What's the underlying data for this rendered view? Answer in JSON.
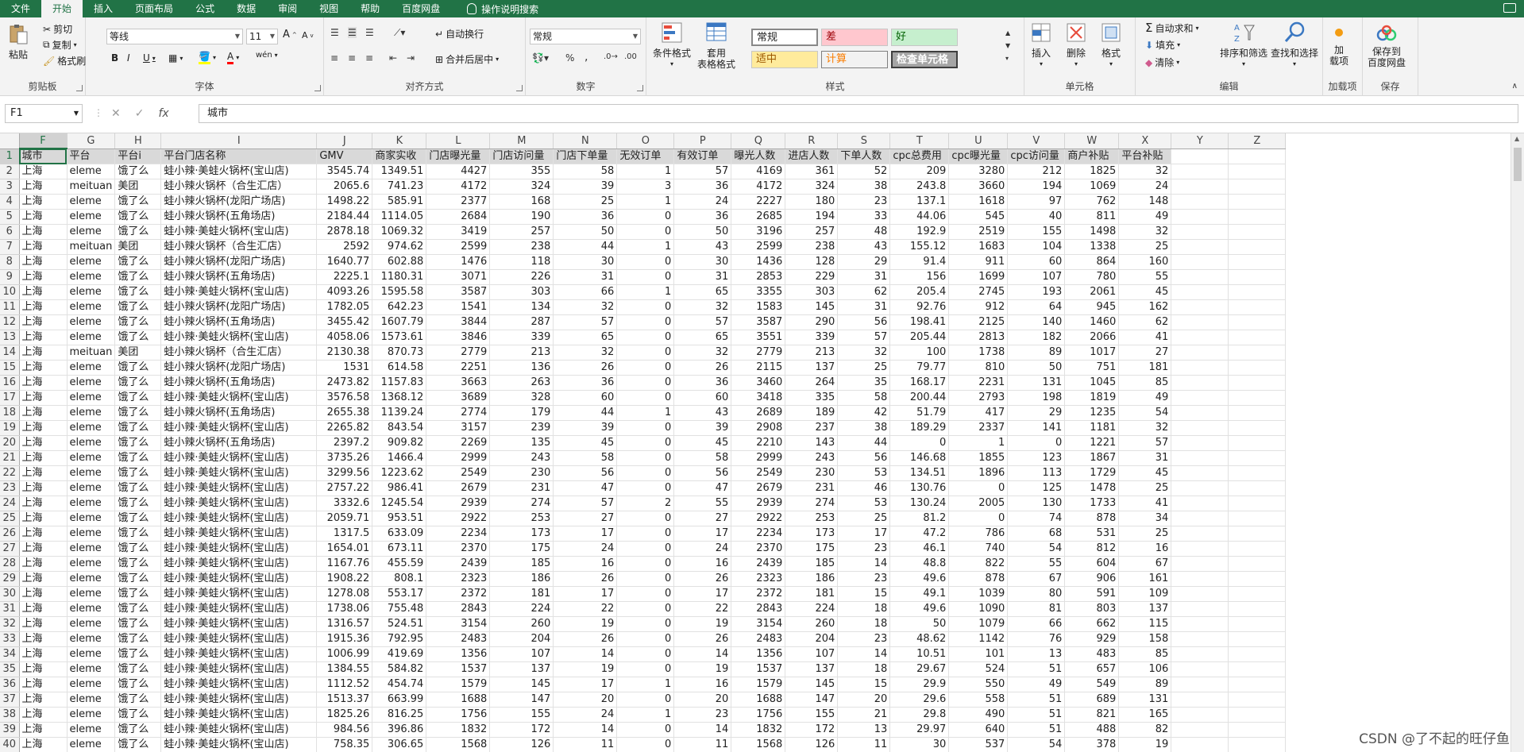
{
  "tabs": [
    "文件",
    "开始",
    "插入",
    "页面布局",
    "公式",
    "数据",
    "审阅",
    "视图",
    "帮助",
    "百度网盘"
  ],
  "active_tab": "开始",
  "tell_me": "操作说明搜索",
  "ribbon": {
    "clipboard": {
      "paste": "粘贴",
      "cut": "剪切",
      "copy": "复制",
      "format_painter": "格式刷",
      "label": "剪贴板"
    },
    "font": {
      "name": "等线",
      "size": "11",
      "grow": "A",
      "shrink": "A",
      "bold": "B",
      "italic": "I",
      "underline": "U",
      "label": "字体",
      "phonetic": "wén"
    },
    "alignment": {
      "wrap": "自动换行",
      "merge": "合并后居中",
      "label": "对齐方式"
    },
    "number": {
      "format": "常规",
      "percent": "%",
      "comma": ",",
      "label": "数字"
    },
    "styles": {
      "conditional": "条件格式",
      "table": "套用\n表格格式",
      "normal": "常规",
      "bad": "差",
      "good": "好",
      "neutral": "适中",
      "calc": "计算",
      "check": "检查单元格",
      "label": "样式"
    },
    "cells": {
      "insert": "插入",
      "delete": "删除",
      "format": "格式",
      "label": "单元格"
    },
    "editing": {
      "autosum": "自动求和",
      "fill": "填充",
      "clear": "清除",
      "sort": "排序和筛选",
      "find": "查找和选择",
      "label": "编辑"
    },
    "addins": {
      "btn": "加\n载项",
      "label": "加载项"
    },
    "save": {
      "btn": "保存到\n百度网盘",
      "label": "保存"
    }
  },
  "colors": {
    "excel_green": "#217346",
    "bad_fill": "#ffc7ce",
    "bad_text": "#9c0006",
    "good_fill": "#c6efce",
    "good_text": "#006100",
    "neutral_fill": "#ffeb9c",
    "neutral_text": "#9c5700",
    "calc_text": "#fa7d00",
    "check_fill": "#a5a5a5"
  },
  "name_box": "F1",
  "formula": "城市",
  "watermark": "CSDN @了不起的旺仔鱼",
  "columns": [
    "F",
    "G",
    "H",
    "I",
    "J",
    "K",
    "L",
    "M",
    "N",
    "O",
    "P",
    "Q",
    "R",
    "S",
    "T",
    "U",
    "V",
    "W",
    "X",
    "Y",
    "Z"
  ],
  "header_row": [
    "城市",
    "平台",
    "平台i",
    "平台门店名称",
    "GMV",
    "商家实收",
    "门店曝光量",
    "门店访问量",
    "门店下单量",
    "无效订单",
    "有效订单",
    "曝光人数",
    "进店人数",
    "下单人数",
    "cpc总费用",
    "cpc曝光量",
    "cpc访问量",
    "商户补贴",
    "平台补贴",
    "",
    ""
  ],
  "rows": [
    [
      "上海",
      "eleme",
      "饿了么",
      "蛙小辣·美蛙火锅杯(宝山店)",
      "3545.74",
      "1349.51",
      "4427",
      "355",
      "58",
      "1",
      "57",
      "4169",
      "361",
      "52",
      "209",
      "3280",
      "212",
      "1825",
      "32"
    ],
    [
      "上海",
      "meituan",
      "美团",
      "蛙小辣火锅杯（合生汇店）",
      "2065.6",
      "741.23",
      "4172",
      "324",
      "39",
      "3",
      "36",
      "4172",
      "324",
      "38",
      "243.8",
      "3660",
      "194",
      "1069",
      "24"
    ],
    [
      "上海",
      "eleme",
      "饿了么",
      "蛙小辣火锅杯(龙阳广场店)",
      "1498.22",
      "585.91",
      "2377",
      "168",
      "25",
      "1",
      "24",
      "2227",
      "180",
      "23",
      "137.1",
      "1618",
      "97",
      "762",
      "148"
    ],
    [
      "上海",
      "eleme",
      "饿了么",
      "蛙小辣火锅杯(五角场店)",
      "2184.44",
      "1114.05",
      "2684",
      "190",
      "36",
      "0",
      "36",
      "2685",
      "194",
      "33",
      "44.06",
      "545",
      "40",
      "811",
      "49"
    ],
    [
      "上海",
      "eleme",
      "饿了么",
      "蛙小辣·美蛙火锅杯(宝山店)",
      "2878.18",
      "1069.32",
      "3419",
      "257",
      "50",
      "0",
      "50",
      "3196",
      "257",
      "48",
      "192.9",
      "2519",
      "155",
      "1498",
      "32"
    ],
    [
      "上海",
      "meituan",
      "美团",
      "蛙小辣火锅杯（合生汇店）",
      "2592",
      "974.62",
      "2599",
      "238",
      "44",
      "1",
      "43",
      "2599",
      "238",
      "43",
      "155.12",
      "1683",
      "104",
      "1338",
      "25"
    ],
    [
      "上海",
      "eleme",
      "饿了么",
      "蛙小辣火锅杯(龙阳广场店)",
      "1640.77",
      "602.88",
      "1476",
      "118",
      "30",
      "0",
      "30",
      "1436",
      "128",
      "29",
      "91.4",
      "911",
      "60",
      "864",
      "160"
    ],
    [
      "上海",
      "eleme",
      "饿了么",
      "蛙小辣火锅杯(五角场店)",
      "2225.1",
      "1180.31",
      "3071",
      "226",
      "31",
      "0",
      "31",
      "2853",
      "229",
      "31",
      "156",
      "1699",
      "107",
      "780",
      "55"
    ],
    [
      "上海",
      "eleme",
      "饿了么",
      "蛙小辣·美蛙火锅杯(宝山店)",
      "4093.26",
      "1595.58",
      "3587",
      "303",
      "66",
      "1",
      "65",
      "3355",
      "303",
      "62",
      "205.4",
      "2745",
      "193",
      "2061",
      "45"
    ],
    [
      "上海",
      "eleme",
      "饿了么",
      "蛙小辣火锅杯(龙阳广场店)",
      "1782.05",
      "642.23",
      "1541",
      "134",
      "32",
      "0",
      "32",
      "1583",
      "145",
      "31",
      "92.76",
      "912",
      "64",
      "945",
      "162"
    ],
    [
      "上海",
      "eleme",
      "饿了么",
      "蛙小辣火锅杯(五角场店)",
      "3455.42",
      "1607.79",
      "3844",
      "287",
      "57",
      "0",
      "57",
      "3587",
      "290",
      "56",
      "198.41",
      "2125",
      "140",
      "1460",
      "62"
    ],
    [
      "上海",
      "eleme",
      "饿了么",
      "蛙小辣·美蛙火锅杯(宝山店)",
      "4058.06",
      "1573.61",
      "3846",
      "339",
      "65",
      "0",
      "65",
      "3551",
      "339",
      "57",
      "205.44",
      "2813",
      "182",
      "2066",
      "41"
    ],
    [
      "上海",
      "meituan",
      "美团",
      "蛙小辣火锅杯（合生汇店）",
      "2130.38",
      "870.73",
      "2779",
      "213",
      "32",
      "0",
      "32",
      "2779",
      "213",
      "32",
      "100",
      "1738",
      "89",
      "1017",
      "27"
    ],
    [
      "上海",
      "eleme",
      "饿了么",
      "蛙小辣火锅杯(龙阳广场店)",
      "1531",
      "614.58",
      "2251",
      "136",
      "26",
      "0",
      "26",
      "2115",
      "137",
      "25",
      "79.77",
      "810",
      "50",
      "751",
      "181"
    ],
    [
      "上海",
      "eleme",
      "饿了么",
      "蛙小辣火锅杯(五角场店)",
      "2473.82",
      "1157.83",
      "3663",
      "263",
      "36",
      "0",
      "36",
      "3460",
      "264",
      "35",
      "168.17",
      "2231",
      "131",
      "1045",
      "85"
    ],
    [
      "上海",
      "eleme",
      "饿了么",
      "蛙小辣·美蛙火锅杯(宝山店)",
      "3576.58",
      "1368.12",
      "3689",
      "328",
      "60",
      "0",
      "60",
      "3418",
      "335",
      "58",
      "200.44",
      "2793",
      "198",
      "1819",
      "49"
    ],
    [
      "上海",
      "eleme",
      "饿了么",
      "蛙小辣火锅杯(五角场店)",
      "2655.38",
      "1139.24",
      "2774",
      "179",
      "44",
      "1",
      "43",
      "2689",
      "189",
      "42",
      "51.79",
      "417",
      "29",
      "1235",
      "54"
    ],
    [
      "上海",
      "eleme",
      "饿了么",
      "蛙小辣·美蛙火锅杯(宝山店)",
      "2265.82",
      "843.54",
      "3157",
      "239",
      "39",
      "0",
      "39",
      "2908",
      "237",
      "38",
      "189.29",
      "2337",
      "141",
      "1181",
      "32"
    ],
    [
      "上海",
      "eleme",
      "饿了么",
      "蛙小辣火锅杯(五角场店)",
      "2397.2",
      "909.82",
      "2269",
      "135",
      "45",
      "0",
      "45",
      "2210",
      "143",
      "44",
      "0",
      "1",
      "0",
      "1221",
      "57"
    ],
    [
      "上海",
      "eleme",
      "饿了么",
      "蛙小辣·美蛙火锅杯(宝山店)",
      "3735.26",
      "1466.4",
      "2999",
      "243",
      "58",
      "0",
      "58",
      "2999",
      "243",
      "56",
      "146.68",
      "1855",
      "123",
      "1867",
      "31"
    ],
    [
      "上海",
      "eleme",
      "饿了么",
      "蛙小辣·美蛙火锅杯(宝山店)",
      "3299.56",
      "1223.62",
      "2549",
      "230",
      "56",
      "0",
      "56",
      "2549",
      "230",
      "53",
      "134.51",
      "1896",
      "113",
      "1729",
      "45"
    ],
    [
      "上海",
      "eleme",
      "饿了么",
      "蛙小辣·美蛙火锅杯(宝山店)",
      "2757.22",
      "986.41",
      "2679",
      "231",
      "47",
      "0",
      "47",
      "2679",
      "231",
      "46",
      "130.76",
      "0",
      "125",
      "1478",
      "25"
    ],
    [
      "上海",
      "eleme",
      "饿了么",
      "蛙小辣·美蛙火锅杯(宝山店)",
      "3332.6",
      "1245.54",
      "2939",
      "274",
      "57",
      "2",
      "55",
      "2939",
      "274",
      "53",
      "130.24",
      "2005",
      "130",
      "1733",
      "41"
    ],
    [
      "上海",
      "eleme",
      "饿了么",
      "蛙小辣·美蛙火锅杯(宝山店)",
      "2059.71",
      "953.51",
      "2922",
      "253",
      "27",
      "0",
      "27",
      "2922",
      "253",
      "25",
      "81.2",
      "0",
      "74",
      "878",
      "34"
    ],
    [
      "上海",
      "eleme",
      "饿了么",
      "蛙小辣·美蛙火锅杯(宝山店)",
      "1317.5",
      "633.09",
      "2234",
      "173",
      "17",
      "0",
      "17",
      "2234",
      "173",
      "17",
      "47.2",
      "786",
      "68",
      "531",
      "25"
    ],
    [
      "上海",
      "eleme",
      "饿了么",
      "蛙小辣·美蛙火锅杯(宝山店)",
      "1654.01",
      "673.11",
      "2370",
      "175",
      "24",
      "0",
      "24",
      "2370",
      "175",
      "23",
      "46.1",
      "740",
      "54",
      "812",
      "16"
    ],
    [
      "上海",
      "eleme",
      "饿了么",
      "蛙小辣·美蛙火锅杯(宝山店)",
      "1167.76",
      "455.59",
      "2439",
      "185",
      "16",
      "0",
      "16",
      "2439",
      "185",
      "14",
      "48.8",
      "822",
      "55",
      "604",
      "67"
    ],
    [
      "上海",
      "eleme",
      "饿了么",
      "蛙小辣·美蛙火锅杯(宝山店)",
      "1908.22",
      "808.1",
      "2323",
      "186",
      "26",
      "0",
      "26",
      "2323",
      "186",
      "23",
      "49.6",
      "878",
      "67",
      "906",
      "161"
    ],
    [
      "上海",
      "eleme",
      "饿了么",
      "蛙小辣·美蛙火锅杯(宝山店)",
      "1278.08",
      "553.17",
      "2372",
      "181",
      "17",
      "0",
      "17",
      "2372",
      "181",
      "15",
      "49.1",
      "1039",
      "80",
      "591",
      "109"
    ],
    [
      "上海",
      "eleme",
      "饿了么",
      "蛙小辣·美蛙火锅杯(宝山店)",
      "1738.06",
      "755.48",
      "2843",
      "224",
      "22",
      "0",
      "22",
      "2843",
      "224",
      "18",
      "49.6",
      "1090",
      "81",
      "803",
      "137"
    ],
    [
      "上海",
      "eleme",
      "饿了么",
      "蛙小辣·美蛙火锅杯(宝山店)",
      "1316.57",
      "524.51",
      "3154",
      "260",
      "19",
      "0",
      "19",
      "3154",
      "260",
      "18",
      "50",
      "1079",
      "66",
      "662",
      "115"
    ],
    [
      "上海",
      "eleme",
      "饿了么",
      "蛙小辣·美蛙火锅杯(宝山店)",
      "1915.36",
      "792.95",
      "2483",
      "204",
      "26",
      "0",
      "26",
      "2483",
      "204",
      "23",
      "48.62",
      "1142",
      "76",
      "929",
      "158"
    ],
    [
      "上海",
      "eleme",
      "饿了么",
      "蛙小辣·美蛙火锅杯(宝山店)",
      "1006.99",
      "419.69",
      "1356",
      "107",
      "14",
      "0",
      "14",
      "1356",
      "107",
      "14",
      "10.51",
      "101",
      "13",
      "483",
      "85"
    ],
    [
      "上海",
      "eleme",
      "饿了么",
      "蛙小辣·美蛙火锅杯(宝山店)",
      "1384.55",
      "584.82",
      "1537",
      "137",
      "19",
      "0",
      "19",
      "1537",
      "137",
      "18",
      "29.67",
      "524",
      "51",
      "657",
      "106"
    ],
    [
      "上海",
      "eleme",
      "饿了么",
      "蛙小辣·美蛙火锅杯(宝山店)",
      "1112.52",
      "454.74",
      "1579",
      "145",
      "17",
      "1",
      "16",
      "1579",
      "145",
      "15",
      "29.9",
      "550",
      "49",
      "549",
      "89"
    ],
    [
      "上海",
      "eleme",
      "饿了么",
      "蛙小辣·美蛙火锅杯(宝山店)",
      "1513.37",
      "663.99",
      "1688",
      "147",
      "20",
      "0",
      "20",
      "1688",
      "147",
      "20",
      "29.6",
      "558",
      "51",
      "689",
      "131"
    ],
    [
      "上海",
      "eleme",
      "饿了么",
      "蛙小辣·美蛙火锅杯(宝山店)",
      "1825.26",
      "816.25",
      "1756",
      "155",
      "24",
      "1",
      "23",
      "1756",
      "155",
      "21",
      "29.8",
      "490",
      "51",
      "821",
      "165"
    ],
    [
      "上海",
      "eleme",
      "饿了么",
      "蛙小辣·美蛙火锅杯(宝山店)",
      "984.56",
      "396.86",
      "1832",
      "172",
      "14",
      "0",
      "14",
      "1832",
      "172",
      "13",
      "29.97",
      "640",
      "51",
      "488",
      "82"
    ],
    [
      "上海",
      "eleme",
      "饿了么",
      "蛙小辣·美蛙火锅杯(宝山店)",
      "758.35",
      "306.65",
      "1568",
      "126",
      "11",
      "0",
      "11",
      "1568",
      "126",
      "11",
      "30",
      "537",
      "54",
      "378",
      "19"
    ]
  ]
}
